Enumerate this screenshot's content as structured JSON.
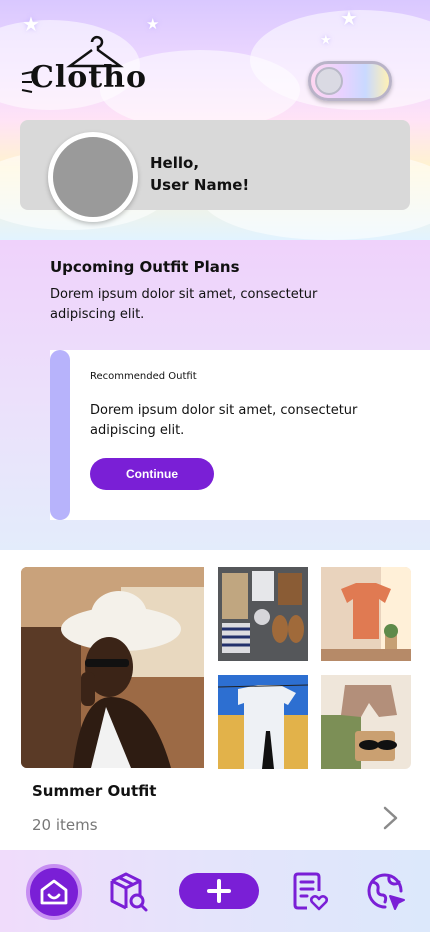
{
  "app": {
    "logo_text": "Clotho"
  },
  "profile": {
    "greeting": "Hello,",
    "username": "User Name!"
  },
  "plans": {
    "title": "Upcoming Outfit Plans",
    "description": "Dorem ipsum dolor sit amet, consectetur adipiscing elit."
  },
  "recommended": {
    "label": "Recommended Outfit",
    "description": "Dorem ipsum dolor sit amet, consectetur adipiscing elit.",
    "button": "Continue"
  },
  "outfit": {
    "name": "Summer Outfit",
    "count": "20 items"
  },
  "nav": {
    "items": [
      "home-icon",
      "wardrobe-search-icon",
      "add-icon",
      "outfit-list-icon",
      "explore-globe-icon"
    ],
    "accent": "#7a1fd6"
  },
  "theme": {
    "accent": "#7a1fd6",
    "card_bar": "#b7b3fb",
    "profile_card": "#d9d9d9"
  }
}
